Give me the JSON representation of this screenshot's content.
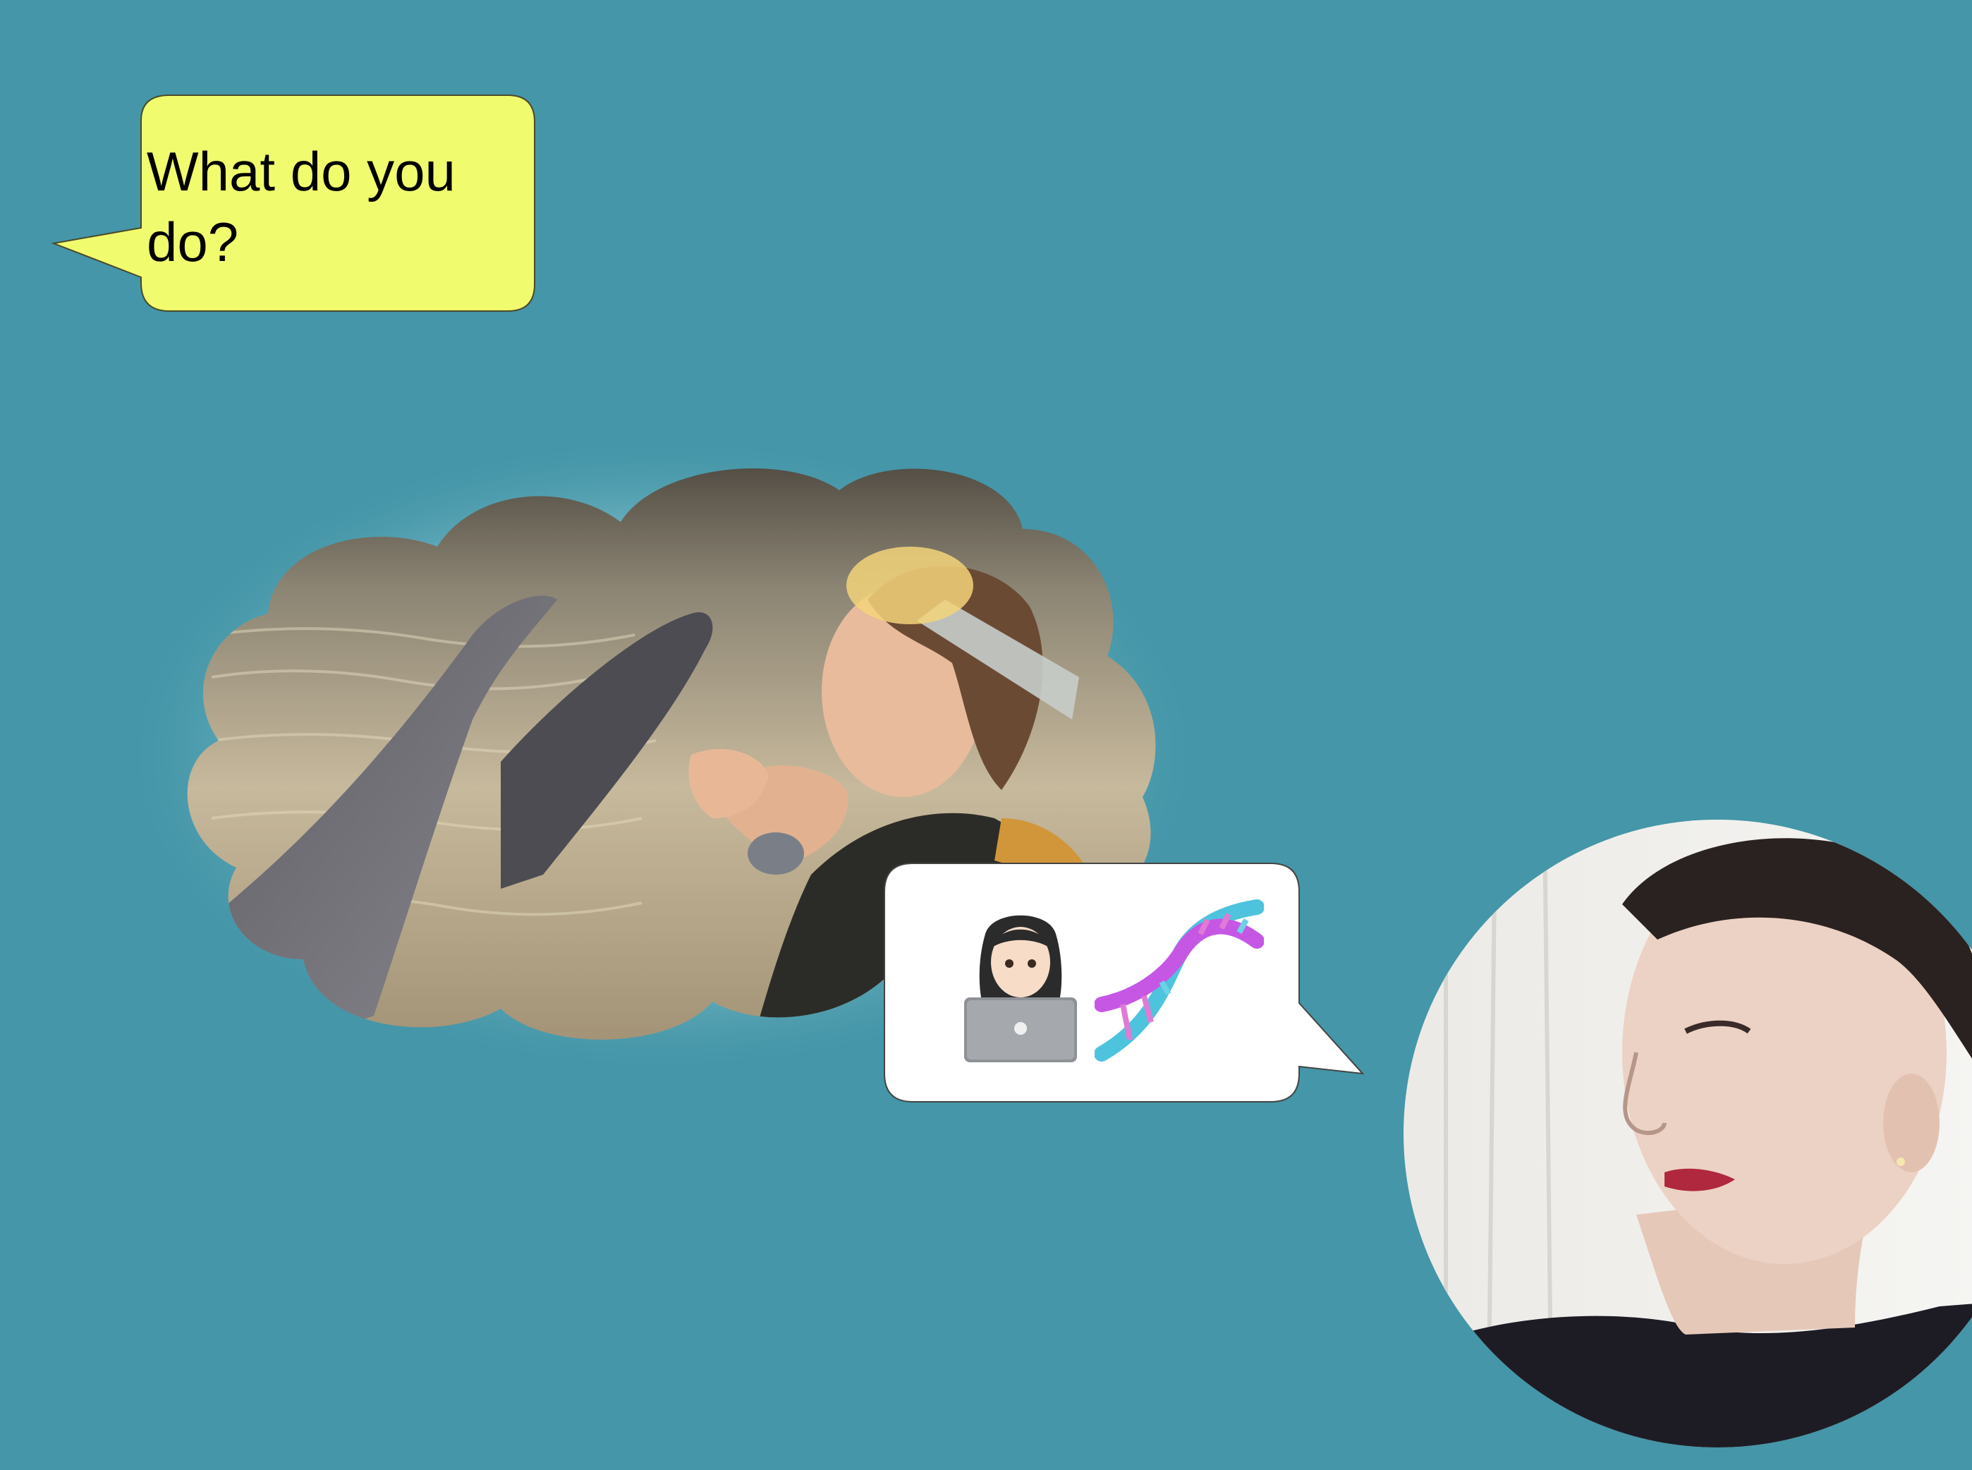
{
  "slide": {
    "background_color": "#4496a8",
    "question_bubble": {
      "text": "What do you do?",
      "fill_color": "#f1fb6e"
    },
    "thought_cloud": {
      "photo_description": "girl-with-dolphin-photo"
    },
    "answer_bubble": {
      "emojis": [
        "woman-technologist-icon",
        "dna-icon"
      ]
    },
    "portrait": {
      "photo": "woman-portrait-photo"
    }
  }
}
